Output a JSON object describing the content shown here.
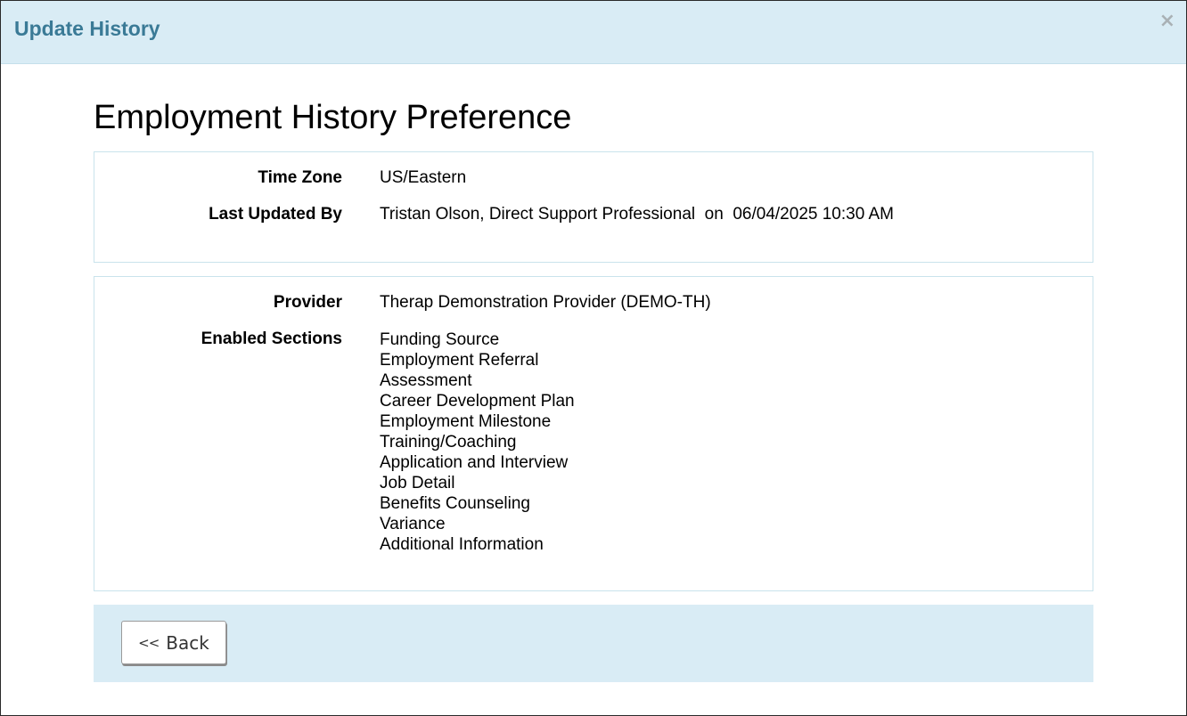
{
  "modal": {
    "title": "Update History",
    "close_icon": "close-icon"
  },
  "page": {
    "title": "Employment History Preference"
  },
  "meta": {
    "time_zone_label": "Time Zone",
    "time_zone_value": "US/Eastern",
    "last_updated_label": "Last Updated By",
    "last_updated_value": "Tristan Olson, Direct Support Professional  on  06/04/2025 10:30 AM"
  },
  "details": {
    "provider_label": "Provider",
    "provider_value": "Therap Demonstration Provider (DEMO-TH)",
    "sections_label": "Enabled Sections",
    "sections": [
      "Funding Source",
      "Employment Referral",
      "Assessment",
      "Career Development Plan",
      "Employment Milestone",
      "Training/Coaching",
      "Application and Interview",
      "Job Detail",
      "Benefits Counseling",
      "Variance",
      "Additional Information"
    ]
  },
  "footer": {
    "back_chevron": "<<",
    "back_label": "Back"
  },
  "colors": {
    "header_bg": "#d9ecf5",
    "title_color": "#3a7a96",
    "panel_border": "#c9e3ec"
  }
}
